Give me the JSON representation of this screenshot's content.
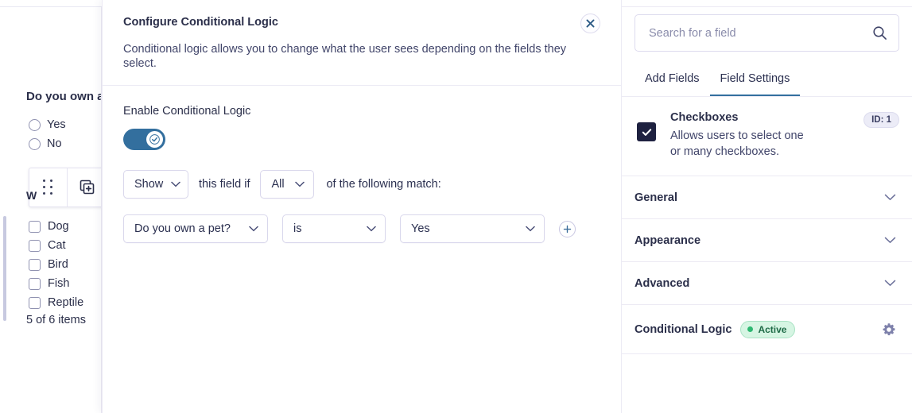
{
  "background": {
    "question": "Do you own a",
    "radio_options": [
      "Yes",
      "No"
    ],
    "field_label_partial": "W",
    "checkbox_options": [
      "Dog",
      "Cat",
      "Bird",
      "Fish",
      "Reptile"
    ],
    "items_count": "5 of 6 items",
    "toolbar": {
      "drag_handle": "drag-handle-icon",
      "duplicate": "duplicate-icon"
    }
  },
  "modal": {
    "title": "Configure Conditional Logic",
    "description": "Conditional logic allows you to change what the user sees depending on the fields they select.",
    "close_label": "close-icon",
    "enable_label": "Enable Conditional Logic",
    "toggle_on": true,
    "action_select": "Show",
    "mid_text": "this field if",
    "match_select": "All",
    "tail_text": "of the following match:",
    "rules": [
      {
        "field": "Do you own a pet?",
        "operator": "is",
        "value": "Yes"
      }
    ],
    "add_rule_label": "plus-icon"
  },
  "sidebar": {
    "search": {
      "placeholder": "Search for a field",
      "value": "",
      "icon": "search-icon"
    },
    "tabs": [
      {
        "label": "Add Fields",
        "active": false
      },
      {
        "label": "Field Settings",
        "active": true
      }
    ],
    "field": {
      "name": "Checkboxes",
      "description": "Allows users to select one or many checkboxes.",
      "checked": true,
      "id_badge": "ID: 1"
    },
    "sections": [
      {
        "label": "General",
        "chevron": "chevron-down-icon"
      },
      {
        "label": "Appearance",
        "chevron": "chevron-down-icon"
      },
      {
        "label": "Advanced",
        "chevron": "chevron-down-icon"
      }
    ],
    "conditional_logic": {
      "label": "Conditional Logic",
      "status": "Active",
      "gear": "gear-icon"
    }
  },
  "colors": {
    "accent_blue": "#336f9e",
    "dark_navy": "#1e2140",
    "status_green": "#2eb872",
    "border_lavender": "#dddbee"
  }
}
